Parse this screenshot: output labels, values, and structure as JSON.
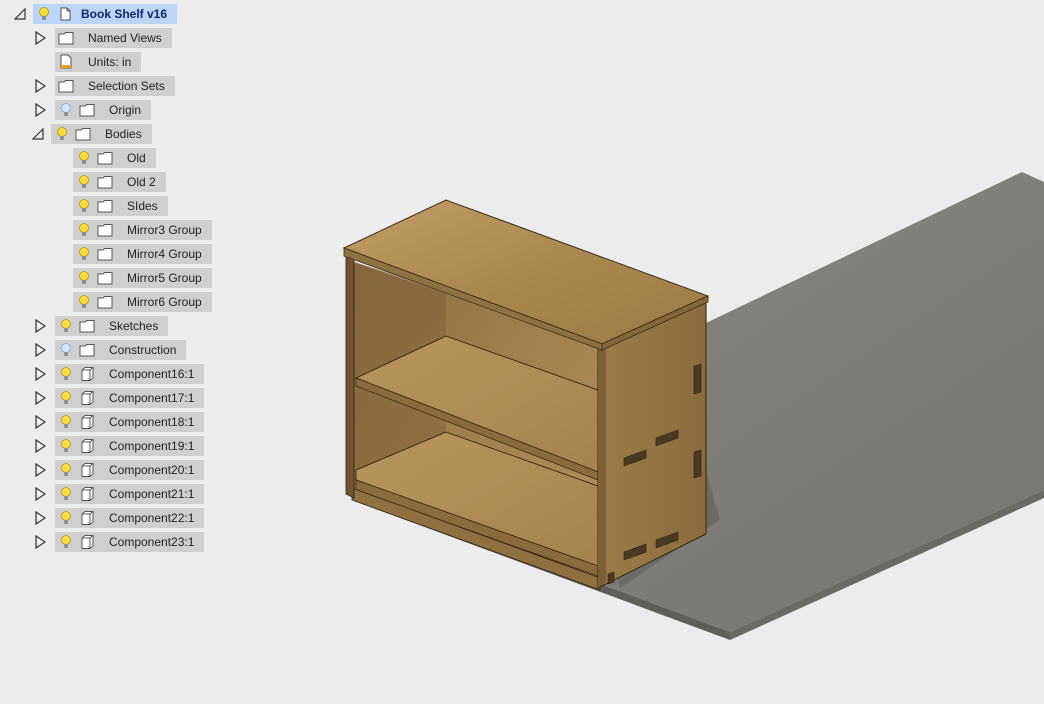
{
  "browser": {
    "root": {
      "label": "Book Shelf v16",
      "icon": "document-icon"
    },
    "nodes": [
      {
        "id": "named-views",
        "label": "Named Views",
        "icon": "folder-icon",
        "expander": "collapsed",
        "bulb": "none",
        "depth": 1
      },
      {
        "id": "units",
        "label": "Units: in",
        "icon": "units-icon",
        "expander": "none",
        "bulb": "none",
        "depth": 1
      },
      {
        "id": "selection-sets",
        "label": "Selection Sets",
        "icon": "folder-icon",
        "expander": "collapsed",
        "bulb": "none",
        "depth": 1
      },
      {
        "id": "origin",
        "label": "Origin",
        "icon": "folder-icon",
        "expander": "collapsed",
        "bulb": "off",
        "depth": 1
      },
      {
        "id": "bodies",
        "label": "Bodies",
        "icon": "folder-icon",
        "expander": "expanded",
        "bulb": "on",
        "depth": 1
      },
      {
        "id": "old",
        "label": "Old",
        "icon": "folder-icon",
        "expander": "none",
        "bulb": "on",
        "depth": 2
      },
      {
        "id": "old-2",
        "label": "Old 2",
        "icon": "folder-icon",
        "expander": "none",
        "bulb": "on",
        "depth": 2
      },
      {
        "id": "sides",
        "label": "SIdes",
        "icon": "folder-icon",
        "expander": "none",
        "bulb": "on",
        "depth": 2
      },
      {
        "id": "mirror3",
        "label": "Mirror3 Group",
        "icon": "folder-icon",
        "expander": "none",
        "bulb": "on",
        "depth": 2
      },
      {
        "id": "mirror4",
        "label": "Mirror4 Group",
        "icon": "folder-icon",
        "expander": "none",
        "bulb": "on",
        "depth": 2
      },
      {
        "id": "mirror5",
        "label": "Mirror5 Group",
        "icon": "folder-icon",
        "expander": "none",
        "bulb": "on",
        "depth": 2
      },
      {
        "id": "mirror6",
        "label": "Mirror6 Group",
        "icon": "folder-icon",
        "expander": "none",
        "bulb": "on",
        "depth": 2
      },
      {
        "id": "sketches",
        "label": "Sketches",
        "icon": "folder-icon",
        "expander": "collapsed",
        "bulb": "on",
        "depth": 1
      },
      {
        "id": "construction",
        "label": "Construction",
        "icon": "folder-icon",
        "expander": "collapsed",
        "bulb": "off",
        "depth": 1
      },
      {
        "id": "component16",
        "label": "Component16:1",
        "icon": "component-icon",
        "expander": "collapsed",
        "bulb": "on",
        "depth": 1
      },
      {
        "id": "component17",
        "label": "Component17:1",
        "icon": "component-icon",
        "expander": "collapsed",
        "bulb": "on",
        "depth": 1
      },
      {
        "id": "component18",
        "label": "Component18:1",
        "icon": "component-icon",
        "expander": "collapsed",
        "bulb": "on",
        "depth": 1
      },
      {
        "id": "component19",
        "label": "Component19:1",
        "icon": "component-icon",
        "expander": "collapsed",
        "bulb": "on",
        "depth": 1
      },
      {
        "id": "component20",
        "label": "Component20:1",
        "icon": "component-icon",
        "expander": "collapsed",
        "bulb": "on",
        "depth": 1
      },
      {
        "id": "component21",
        "label": "Component21:1",
        "icon": "component-icon",
        "expander": "collapsed",
        "bulb": "on",
        "depth": 1
      },
      {
        "id": "component22",
        "label": "Component22:1",
        "icon": "component-icon",
        "expander": "collapsed",
        "bulb": "on",
        "depth": 1
      },
      {
        "id": "component23",
        "label": "Component23:1",
        "icon": "component-icon",
        "expander": "collapsed",
        "bulb": "on",
        "depth": 1
      }
    ]
  },
  "colors": {
    "background": "#ececec",
    "row_background": "#cfcfcf",
    "selected_background": "#bcd4f6",
    "bulb_on": "#f6dc3c",
    "bulb_off": "#a9c7ea",
    "wood": "#b08d5a",
    "ground_plane": "#888680"
  }
}
